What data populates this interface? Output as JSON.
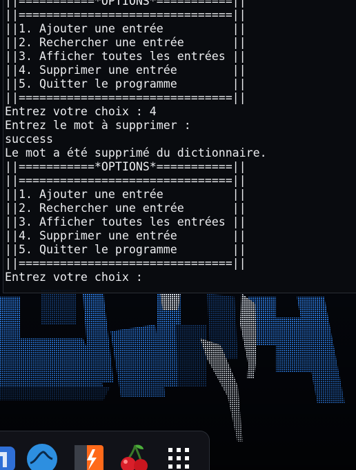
{
  "terminal": {
    "lines": [
      "||===========*OPTIONS*===========||",
      "||===============================||",
      "||1. Ajouter une entrée          ||",
      "||2. Rechercher une entrée       ||",
      "||3. Afficher toutes les entrées ||",
      "||4. Supprimer une entrée        ||",
      "||5. Quitter le programme        ||",
      "||===============================||",
      "Entrez votre choix : 4",
      "Entrez le mot à supprimer :",
      "success",
      "Le mot a été supprimé du dictionnaire.",
      "||===========*OPTIONS*===========||",
      "||===============================||",
      "||1. Ajouter une entrée          ||",
      "||2. Rechercher une entrée       ||",
      "||3. Afficher toutes les entrées ||",
      "||4. Supprimer une entrée        ||",
      "||5. Quitter le programme        ||",
      "||===============================||",
      "Entrez votre choix : "
    ]
  },
  "dock": {
    "icons": [
      {
        "name": "blue-app-icon",
        "color": "#2f6fd6"
      },
      {
        "name": "wireshark-icon",
        "color": "#2d8fe0"
      },
      {
        "name": "burpsuite-icon",
        "color": "#ff6a1a"
      },
      {
        "name": "cherrytree-icon",
        "color": "#d91f2a"
      },
      {
        "name": "app-grid-icon",
        "color": "#ffffff"
      }
    ]
  },
  "colors": {
    "terminal_text": "#ecedf0",
    "terminal_bg": "#0a0c10",
    "wallpaper_glow": "#1f6fd8"
  }
}
